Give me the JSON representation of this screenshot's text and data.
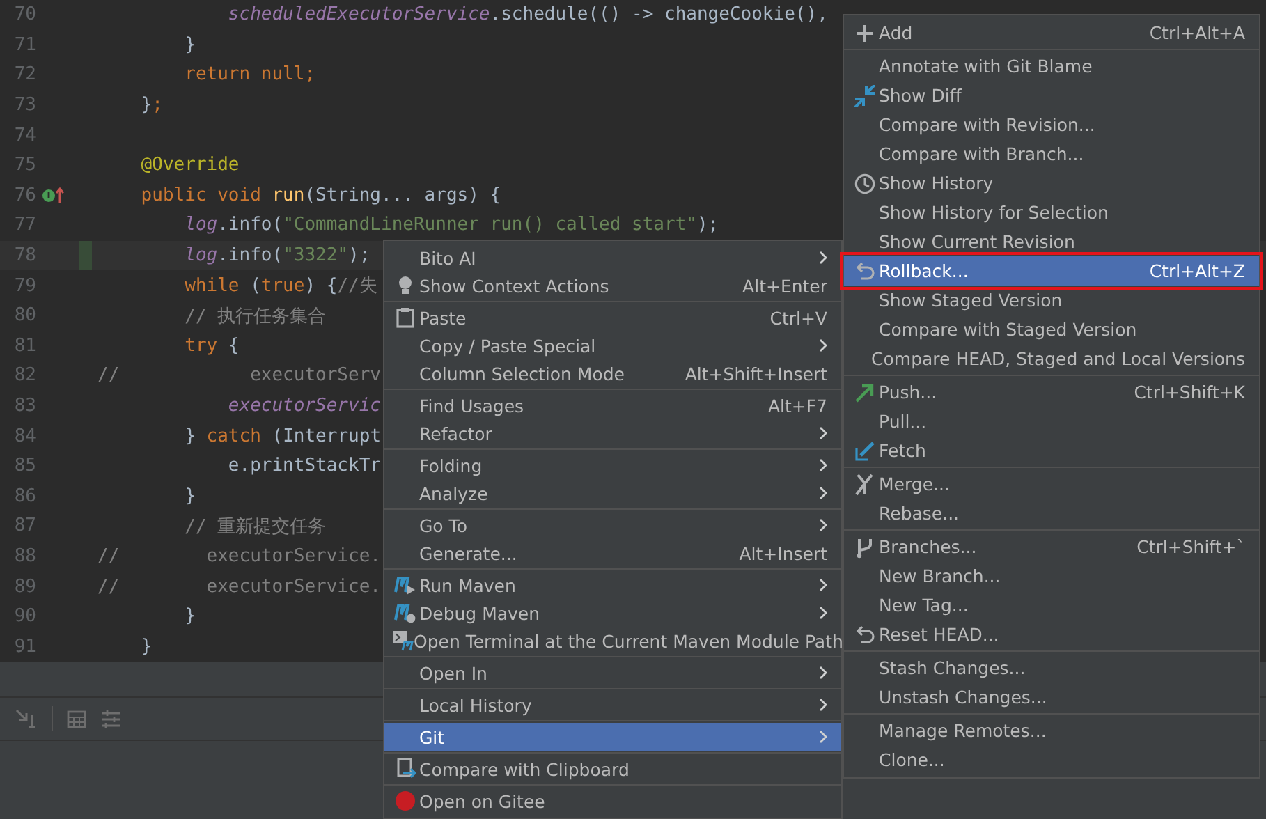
{
  "editor": {
    "lines": [
      {
        "number": "70",
        "current": false,
        "segments": [
          {
            "kind": "field",
            "text": "            scheduledExecutorService"
          },
          {
            "kind": "plain",
            "text": ".schedule(() -> changeCookie(),"
          }
        ]
      },
      {
        "number": "71",
        "current": false,
        "segments": [
          {
            "kind": "plain",
            "text": "        }"
          }
        ]
      },
      {
        "number": "72",
        "current": false,
        "segments": [
          {
            "kind": "keyword",
            "text": "        return null;"
          }
        ]
      },
      {
        "number": "73",
        "current": false,
        "segments": [
          {
            "kind": "plain",
            "text": "    }"
          },
          {
            "kind": "keyword",
            "text": ";"
          }
        ]
      },
      {
        "number": "74",
        "current": false
      },
      {
        "number": "75",
        "current": false,
        "segments": [
          {
            "kind": "annotation",
            "text": "    @Override"
          }
        ]
      },
      {
        "number": "76",
        "current": false,
        "segments": [
          {
            "kind": "keyword",
            "text": "    public void "
          },
          {
            "kind": "method",
            "text": "run"
          },
          {
            "kind": "plain",
            "text": "(String... args) {"
          }
        ]
      },
      {
        "number": "77",
        "current": false,
        "segments": [
          {
            "kind": "field",
            "text": "        log"
          },
          {
            "kind": "plain",
            "text": ".info("
          },
          {
            "kind": "string",
            "text": "\"CommandLineRunner run() called start\""
          },
          {
            "kind": "plain",
            "text": ");"
          }
        ]
      },
      {
        "number": "78",
        "current": true,
        "segments": [
          {
            "kind": "field",
            "text": "        log"
          },
          {
            "kind": "plain",
            "text": ".info("
          },
          {
            "kind": "string",
            "text": "\"3322\""
          },
          {
            "kind": "plain",
            "text": ");"
          }
        ]
      },
      {
        "number": "79",
        "current": false,
        "segments": [
          {
            "kind": "keyword",
            "text": "        while "
          },
          {
            "kind": "plain",
            "text": "("
          },
          {
            "kind": "keyword",
            "text": "true"
          },
          {
            "kind": "plain",
            "text": ") {"
          },
          {
            "kind": "comment",
            "text": "//失"
          }
        ]
      },
      {
        "number": "80",
        "current": false,
        "segments": [
          {
            "kind": "comment",
            "text": "        // 执行任务集合"
          }
        ]
      },
      {
        "number": "81",
        "current": false,
        "segments": [
          {
            "kind": "keyword",
            "text": "        try "
          },
          {
            "kind": "plain",
            "text": "{"
          }
        ]
      },
      {
        "number": "82",
        "current": false,
        "segments": [
          {
            "kind": "comment",
            "text": "//            executorServ"
          }
        ]
      },
      {
        "number": "83",
        "current": false,
        "segments": [
          {
            "kind": "field",
            "text": "            executorServic"
          }
        ]
      },
      {
        "number": "84",
        "current": false,
        "segments": [
          {
            "kind": "plain",
            "text": "        } "
          },
          {
            "kind": "keyword",
            "text": "catch "
          },
          {
            "kind": "plain",
            "text": "(Interrupt"
          }
        ]
      },
      {
        "number": "85",
        "current": false,
        "segments": [
          {
            "kind": "plain",
            "text": "            e.printStackTr"
          }
        ]
      },
      {
        "number": "86",
        "current": false,
        "segments": [
          {
            "kind": "plain",
            "text": "        }"
          }
        ]
      },
      {
        "number": "87",
        "current": false,
        "segments": [
          {
            "kind": "comment",
            "text": "        // 重新提交任务"
          }
        ]
      },
      {
        "number": "88",
        "current": false,
        "segments": [
          {
            "kind": "comment",
            "text": "//        executorService."
          }
        ]
      },
      {
        "number": "89",
        "current": false,
        "segments": [
          {
            "kind": "comment",
            "text": "//        executorService."
          }
        ]
      },
      {
        "number": "90",
        "current": false,
        "segments": [
          {
            "kind": "plain",
            "text": "        }"
          }
        ]
      },
      {
        "number": "91",
        "current": false,
        "segments": [
          {
            "kind": "plain",
            "text": "    }"
          }
        ]
      }
    ]
  },
  "context_menu": {
    "groups": [
      [
        {
          "label": "Bito AI",
          "submenu": true,
          "selected": false
        },
        {
          "label": "Show Context Actions",
          "shortcut": "Alt+Enter",
          "submenu": false,
          "selected": false
        }
      ],
      [
        {
          "label": "Paste",
          "shortcut": "Ctrl+V",
          "submenu": false,
          "selected": false
        },
        {
          "label": "Copy / Paste Special",
          "submenu": true,
          "selected": false
        },
        {
          "label": "Column Selection Mode",
          "shortcut": "Alt+Shift+Insert",
          "submenu": false,
          "selected": false
        }
      ],
      [
        {
          "label": "Find Usages",
          "shortcut": "Alt+F7",
          "submenu": false,
          "selected": false
        },
        {
          "label": "Refactor",
          "submenu": true,
          "selected": false
        }
      ],
      [
        {
          "label": "Folding",
          "submenu": true,
          "selected": false
        },
        {
          "label": "Analyze",
          "submenu": true,
          "selected": false
        }
      ],
      [
        {
          "label": "Go To",
          "submenu": true,
          "selected": false
        },
        {
          "label": "Generate...",
          "shortcut": "Alt+Insert",
          "submenu": false,
          "selected": false
        }
      ],
      [
        {
          "label": "Run Maven",
          "submenu": true,
          "selected": false
        },
        {
          "label": "Debug Maven",
          "submenu": true,
          "selected": false
        },
        {
          "label": "Open Terminal at the Current Maven Module Path",
          "submenu": false,
          "selected": false
        }
      ],
      [
        {
          "label": "Open In",
          "submenu": true,
          "selected": false
        }
      ],
      [
        {
          "label": "Local History",
          "submenu": true,
          "selected": false
        }
      ],
      [
        {
          "label": "Git",
          "submenu": true,
          "selected": true
        }
      ],
      [
        {
          "label": "Compare with Clipboard",
          "submenu": false,
          "selected": false
        }
      ],
      [
        {
          "label": "Open on Gitee",
          "submenu": false,
          "selected": false
        }
      ]
    ]
  },
  "git_submenu": {
    "groups": [
      [
        {
          "label": "Add",
          "shortcut": "Ctrl+Alt+A",
          "selected": false,
          "framed": false
        }
      ],
      [
        {
          "label": "Annotate with Git Blame",
          "selected": false,
          "framed": false
        },
        {
          "label": "Show Diff",
          "selected": false,
          "framed": false
        },
        {
          "label": "Compare with Revision...",
          "selected": false,
          "framed": false
        },
        {
          "label": "Compare with Branch...",
          "selected": false,
          "framed": false
        },
        {
          "label": "Show History",
          "selected": false,
          "framed": false
        },
        {
          "label": "Show History for Selection",
          "selected": false,
          "framed": false
        },
        {
          "label": "Show Current Revision",
          "selected": false,
          "framed": false
        },
        {
          "label": "Rollback...",
          "shortcut": "Ctrl+Alt+Z",
          "selected": true,
          "framed": true
        },
        {
          "label": "Show Staged Version",
          "selected": false,
          "framed": false
        },
        {
          "label": "Compare with Staged Version",
          "selected": false,
          "framed": false
        },
        {
          "label": "Compare HEAD, Staged and Local Versions",
          "selected": false,
          "framed": false
        }
      ],
      [
        {
          "label": "Push...",
          "shortcut": "Ctrl+Shift+K",
          "selected": false,
          "framed": false
        },
        {
          "label": "Pull...",
          "selected": false,
          "framed": false
        },
        {
          "label": "Fetch",
          "selected": false,
          "framed": false
        }
      ],
      [
        {
          "label": "Merge...",
          "selected": false,
          "framed": false
        },
        {
          "label": "Rebase...",
          "selected": false,
          "framed": false
        }
      ],
      [
        {
          "label": "Branches...",
          "shortcut": "Ctrl+Shift+`",
          "selected": false,
          "framed": false
        },
        {
          "label": "New Branch...",
          "selected": false,
          "framed": false
        },
        {
          "label": "New Tag...",
          "selected": false,
          "framed": false
        },
        {
          "label": "Reset HEAD...",
          "selected": false,
          "framed": false
        }
      ],
      [
        {
          "label": "Stash Changes...",
          "selected": false,
          "framed": false
        },
        {
          "label": "Unstash Changes...",
          "selected": false,
          "framed": false
        }
      ],
      [
        {
          "label": "Manage Remotes...",
          "selected": false,
          "framed": false
        },
        {
          "label": "Clone...",
          "selected": false,
          "framed": false
        }
      ]
    ]
  }
}
